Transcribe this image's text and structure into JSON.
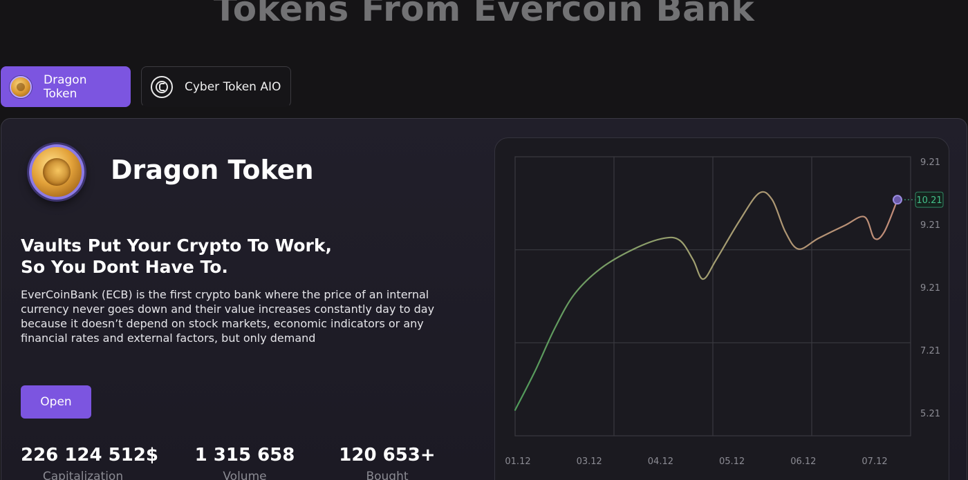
{
  "page": {
    "title": "Tokens From Evercoin Bank"
  },
  "tabs": [
    {
      "label": "Dragon Token",
      "icon": "dragon-coin-icon",
      "active": true
    },
    {
      "label": "Cyber Token AIO",
      "icon": "cyber-token-icon",
      "active": false
    }
  ],
  "token": {
    "name": "Dragon Token",
    "headline_line1": "Vaults Put Your Crypto To Work,",
    "headline_line2": "So You Dont Have To.",
    "description": "EverCoinBank (ECB) is the first crypto bank where the price of an internal currency never goes down and their value increases constantly day to day because it doesn’t depend on stock markets, economic indicators or any financial rates and external factors, but only demand",
    "open_label": "Open",
    "stats": [
      {
        "value": "226 124 512$",
        "label": "Capitalization"
      },
      {
        "value": "1 315 658",
        "label": "Volume"
      },
      {
        "value": "120 653+",
        "label": "Bought"
      }
    ]
  },
  "colors": {
    "accent": "#7c55e0",
    "background": "#151416",
    "card": "#211f2a",
    "price_badge": "#43c08a"
  },
  "chart_data": {
    "type": "line",
    "x_tick_labels": [
      "01.12",
      "03.12",
      "04.12",
      "05.12",
      "06.12",
      "07.12"
    ],
    "y_tick_labels": [
      "9.21",
      "9.21",
      "9.21",
      "7.21",
      "5.21"
    ],
    "current_value_label": "10.21",
    "grid": true,
    "series": [
      {
        "points": [
          [
            0.0,
            5.6
          ],
          [
            0.3,
            6.5
          ],
          [
            0.6,
            7.5
          ],
          [
            0.9,
            8.3
          ],
          [
            1.3,
            8.9
          ],
          [
            1.8,
            9.35
          ],
          [
            2.25,
            9.6
          ],
          [
            2.5,
            9.55
          ],
          [
            2.7,
            9.1
          ],
          [
            2.85,
            8.65
          ],
          [
            3.05,
            9.1
          ],
          [
            3.4,
            10.0
          ],
          [
            3.7,
            10.65
          ],
          [
            3.9,
            10.5
          ],
          [
            4.1,
            9.75
          ],
          [
            4.3,
            9.35
          ],
          [
            4.6,
            9.6
          ],
          [
            5.0,
            9.9
          ],
          [
            5.3,
            10.1
          ],
          [
            5.45,
            9.6
          ],
          [
            5.6,
            9.75
          ],
          [
            5.8,
            10.5
          ]
        ]
      }
    ],
    "ylim": [
      5.0,
      11.5
    ],
    "xlim": [
      0,
      6
    ]
  }
}
